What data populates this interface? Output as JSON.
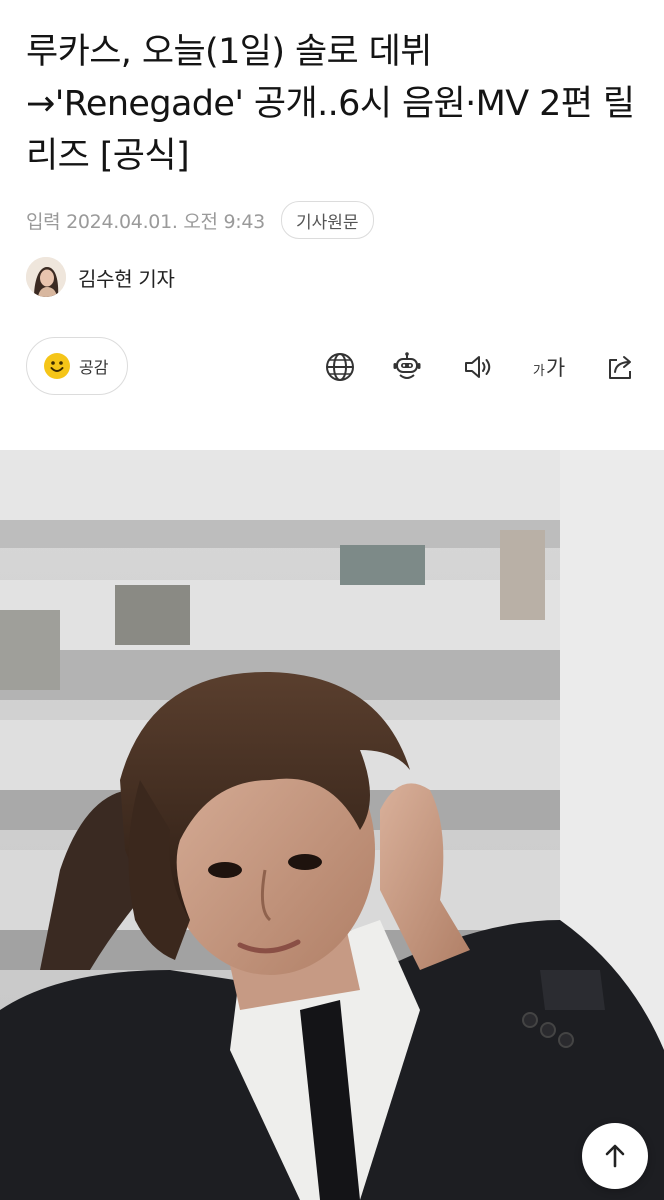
{
  "article": {
    "headline": "루카스, 오늘(1일) 솔로 데뷔 →'Renegade' 공개..6시 음원·MV 2편 릴리즈 [공식]",
    "date_label": "입력 2024.04.01. 오전 9:43",
    "origin_button": "기사원문",
    "reporter": "김수현 기자"
  },
  "toolbar": {
    "like_label": "공감",
    "font_small": "가",
    "font_big": "가",
    "icons": [
      "globe-icon",
      "robot-icon",
      "speaker-icon",
      "font-size-icon",
      "share-icon"
    ]
  },
  "colors": {
    "accent_yellow": "#f5c518",
    "text_primary": "#141414",
    "text_muted": "#9a9a9a",
    "border": "#dcdcdc"
  }
}
